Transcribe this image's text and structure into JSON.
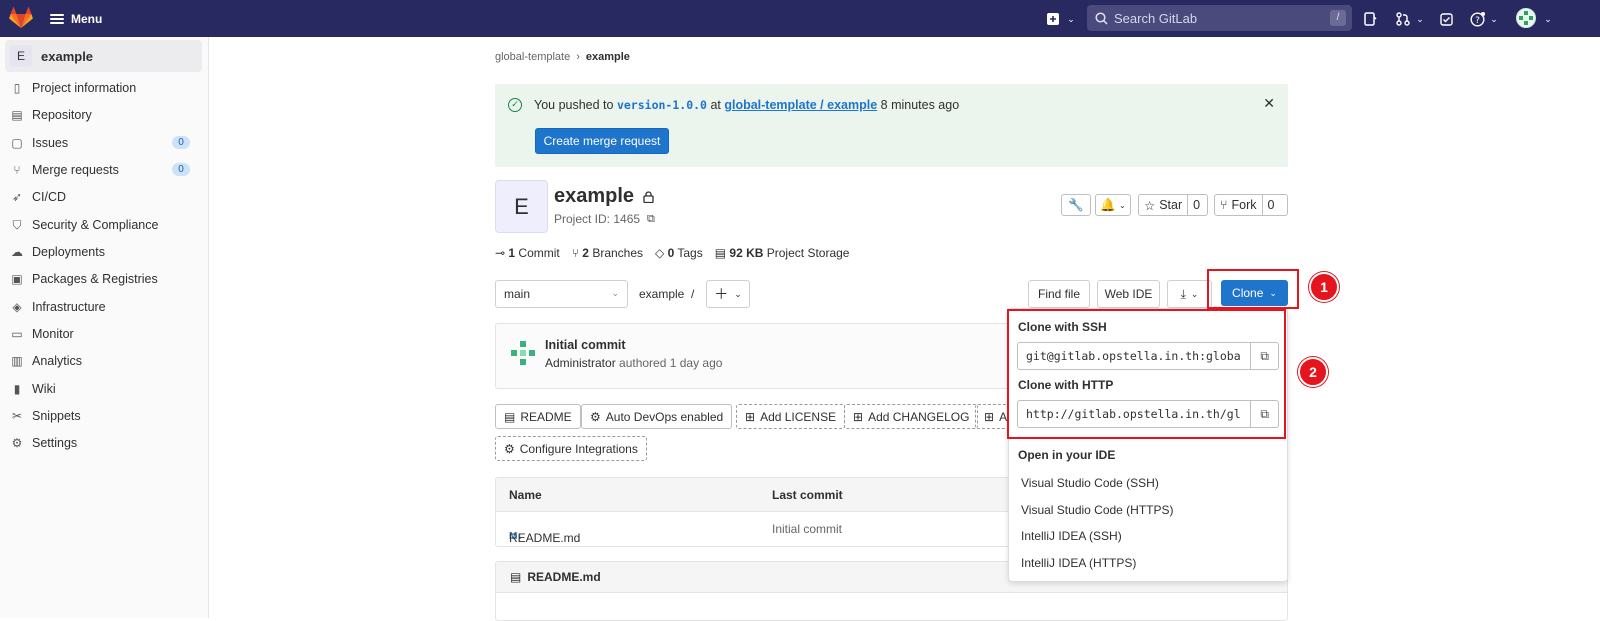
{
  "topbar": {
    "menu_label": "Menu",
    "search_placeholder": "Search GitLab",
    "search_shortcut": "/",
    "brand_color": "#292961"
  },
  "sidebar": {
    "project_avatar": "E",
    "project_name": "example",
    "items": [
      {
        "label": "Project information",
        "icon": "info-doc-icon"
      },
      {
        "label": "Repository",
        "icon": "doc-icon"
      },
      {
        "label": "Issues",
        "icon": "issues-icon",
        "badge": "0"
      },
      {
        "label": "Merge requests",
        "icon": "merge-request-icon",
        "badge": "0"
      },
      {
        "label": "CI/CD",
        "icon": "rocket-icon"
      },
      {
        "label": "Security & Compliance",
        "icon": "shield-icon"
      },
      {
        "label": "Deployments",
        "icon": "cloud-icon"
      },
      {
        "label": "Packages & Registries",
        "icon": "package-icon"
      },
      {
        "label": "Infrastructure",
        "icon": "infrastructure-icon"
      },
      {
        "label": "Monitor",
        "icon": "monitor-icon"
      },
      {
        "label": "Analytics",
        "icon": "chart-icon"
      },
      {
        "label": "Wiki",
        "icon": "book-icon"
      },
      {
        "label": "Snippets",
        "icon": "scissors-icon"
      },
      {
        "label": "Settings",
        "icon": "gear-icon"
      }
    ]
  },
  "breadcrumb": {
    "parent": "global-template",
    "sep": "›",
    "current": "example"
  },
  "alert": {
    "prefix": "You pushed to ",
    "branch": "version-1.0.0",
    "at": " at ",
    "link": "global-template / example",
    "suffix": " 8 minutes ago",
    "button": "Create merge request"
  },
  "project": {
    "avatar": "E",
    "name": "example",
    "id_text": "Project ID: 1465",
    "star_label": "Star",
    "star_count": "0",
    "fork_label": "Fork",
    "fork_count": "0"
  },
  "stats": {
    "commits_n": "1",
    "commits_l": " Commit",
    "branches_n": "2",
    "branches_l": " Branches",
    "tags_n": "0",
    "tags_l": " Tags",
    "storage_n": "92 KB",
    "storage_l": " Project Storage"
  },
  "toolbar": {
    "branch": "main",
    "path": "example",
    "path_sep": "/",
    "find_file": "Find file",
    "web_ide": "Web IDE",
    "clone": "Clone"
  },
  "commit": {
    "title": "Initial commit",
    "author": "Administrator",
    "meta": " authored 1 day ago"
  },
  "chips": {
    "readme": "README",
    "autodevops": "Auto DevOps enabled",
    "license": "Add LICENSE",
    "changelog": "Add CHANGELOG",
    "cut": "A",
    "integrations": "Configure Integrations"
  },
  "files": {
    "col_name": "Name",
    "col_last_commit": "Last commit",
    "rows": [
      {
        "name": "README.md",
        "last_commit": "Initial commit"
      }
    ]
  },
  "readme_header": "README.md",
  "clone_dropdown": {
    "ssh_title": "Clone with SSH",
    "ssh_url": "git@gitlab.opstella.in.th:globa",
    "http_title": "Clone with HTTP",
    "http_url": "http://gitlab.opstella.in.th/gl",
    "ide_title": "Open in your IDE",
    "ide_items": [
      "Visual Studio Code (SSH)",
      "Visual Studio Code (HTTPS)",
      "IntelliJ IDEA (SSH)",
      "IntelliJ IDEA (HTTPS)"
    ]
  },
  "annotations": {
    "step1": "1",
    "step2": "2",
    "color": "#e4151f"
  }
}
